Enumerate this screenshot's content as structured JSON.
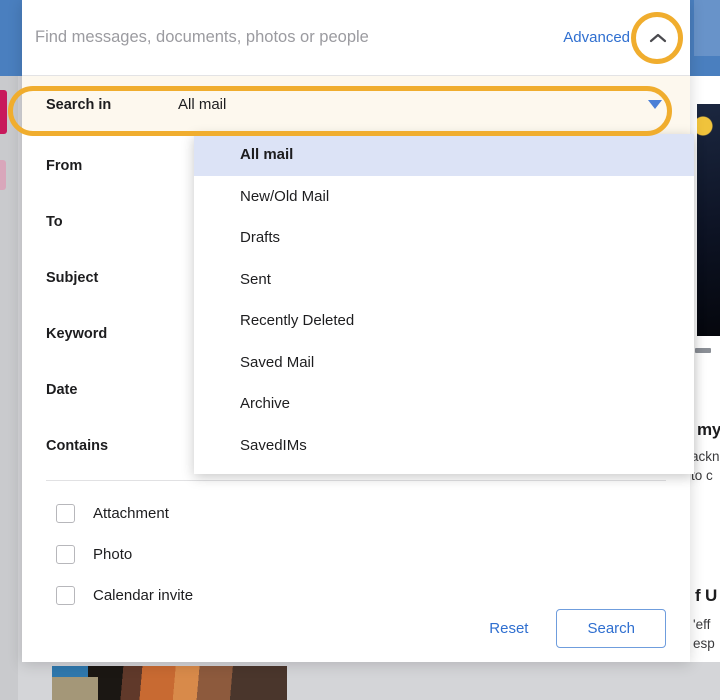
{
  "search_bar": {
    "placeholder": "Find messages, documents, photos or people",
    "value": "",
    "advanced_label": "Advanced",
    "collapse_icon": "chevron-up-icon"
  },
  "search_in": {
    "label": "Search in",
    "selected_value": "All mail",
    "caret_icon": "chevron-down-icon",
    "options": [
      "All mail",
      "New/Old Mail",
      "Drafts",
      "Sent",
      "Recently Deleted",
      "Saved Mail",
      "Archive",
      "SavedIMs"
    ]
  },
  "fields": [
    {
      "label": "From",
      "value": ""
    },
    {
      "label": "To",
      "value": ""
    },
    {
      "label": "Subject",
      "value": ""
    },
    {
      "label": "Keyword",
      "value": ""
    },
    {
      "label": "Date",
      "value": ""
    },
    {
      "label": "Contains",
      "value": ""
    }
  ],
  "checkboxes": [
    {
      "label": "Attachment",
      "checked": false
    },
    {
      "label": "Photo",
      "checked": false
    },
    {
      "label": "Calendar invite",
      "checked": false
    }
  ],
  "actions": {
    "reset_label": "Reset",
    "search_label": "Search"
  },
  "highlights": {
    "color": "#f0ad2e",
    "targets": [
      "collapse-chevron",
      "search-in-row"
    ]
  },
  "background": {
    "article_1_heading": "my",
    "article_1_body_line1": "ackn",
    "article_1_body_line2": "to c",
    "article_2_heading": "f U",
    "article_2_body_line1": "'eff",
    "article_2_body_line2": "esp"
  },
  "colors": {
    "accent_blue": "#2f6fd0",
    "header_blue": "#4a7fbf",
    "highlight_orange": "#f0ad2e",
    "selected_row": "#dce3f6",
    "search_in_bg": "#fdf8ee",
    "page_bg": "#c9cacd"
  }
}
